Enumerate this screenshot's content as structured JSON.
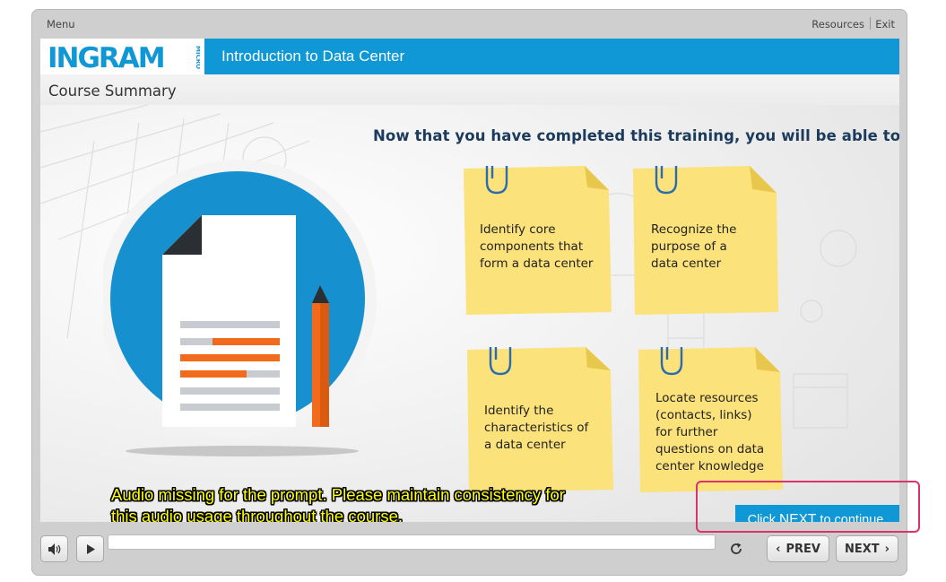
{
  "topbar": {
    "menu": "Menu",
    "resources": "Resources",
    "exit": "Exit"
  },
  "header": {
    "logo": "INGRAM MICRO",
    "course_title": "Introduction to Data Center"
  },
  "page_title": "Course Summary",
  "prompt_heading": "Now that you have completed this training, you will be able to:",
  "notes": [
    {
      "lines": [
        "Identify core",
        "components that",
        "form a data center"
      ]
    },
    {
      "lines": [
        "Recognize the",
        "purpose of a",
        "data center"
      ]
    },
    {
      "lines": [
        "Identify the",
        "characteristics of",
        "a data center"
      ]
    },
    {
      "lines": [
        "Locate resources",
        "(contacts, links)",
        "for further",
        "questions on data",
        "center knowledge"
      ]
    }
  ],
  "audio_warning": {
    "line1": "Audio missing for the prompt. Please maintain consistency for",
    "line2": "this audio usage throughout the course."
  },
  "next_prompt": {
    "pre": "Click ",
    "emphasis": "NEXT",
    "post": " to continue."
  },
  "controls": {
    "prev": "PREV",
    "next": "NEXT"
  },
  "colors": {
    "brand_blue": "#0f97d6",
    "note_yellow": "#fbe27a",
    "accent_orange": "#f26b1d",
    "annotation_pink": "#d9336b",
    "warning_yellow": "#ffff00"
  },
  "icons": {
    "volume": "speaker-icon",
    "play": "play-icon",
    "replay": "replay-icon",
    "prev": "chevron-left-icon",
    "next": "chevron-right-icon",
    "paperclip": "paperclip-icon",
    "document": "document-icon",
    "pencil": "pencil-icon"
  }
}
